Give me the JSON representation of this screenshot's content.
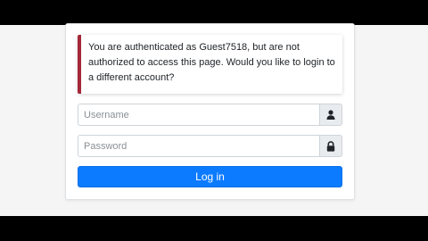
{
  "alert": {
    "message": "You are authenticated as Guest7518, but are not authorized to access this page. Would you like to login to a different account?"
  },
  "form": {
    "username": {
      "value": "",
      "placeholder": "Username",
      "icon": "user-icon"
    },
    "password": {
      "value": "",
      "placeholder": "Password",
      "icon": "lock-icon"
    },
    "submit_label": "Log in"
  },
  "colors": {
    "alert_accent": "#a5273a",
    "button": "#0d7bff",
    "letterbox": "#000000"
  }
}
